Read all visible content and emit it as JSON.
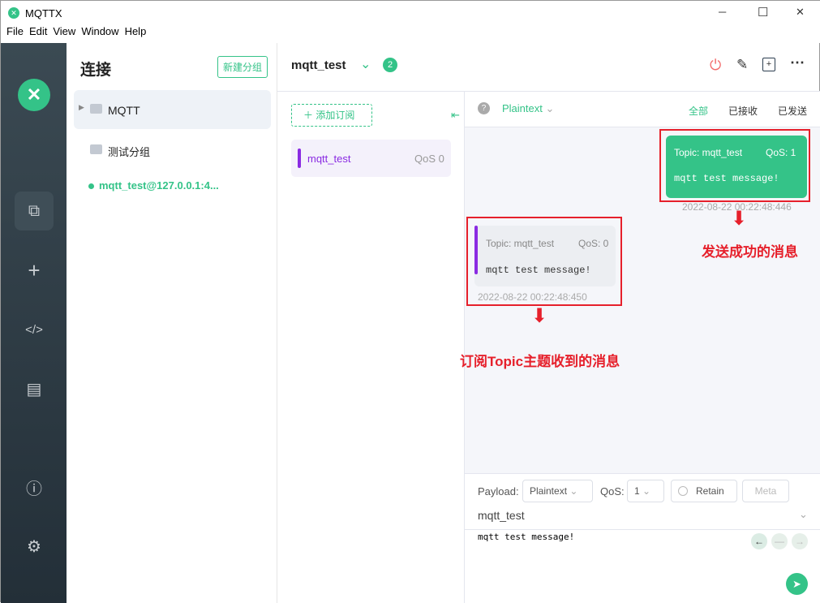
{
  "window": {
    "title": "MQTTX",
    "minimize": "─",
    "maximize": "☐",
    "close": "✕"
  },
  "menu": [
    "File",
    "Edit",
    "View",
    "Window",
    "Help"
  ],
  "connections": {
    "title": "连接",
    "new_group": "新建分组",
    "groups": [
      "MQTT",
      "测试分组"
    ],
    "active": "mqtt_test@127.0.0.1:4..."
  },
  "header": {
    "name": "mqtt_test",
    "badge": "2"
  },
  "subscriptions": {
    "add": "添加订阅",
    "items": [
      {
        "topic": "mqtt_test",
        "qos": "QoS 0",
        "color": "#8a2be2"
      }
    ]
  },
  "messages": {
    "format": "Plaintext",
    "filters": [
      "全部",
      "已接收",
      "已发送"
    ],
    "sent": {
      "topic": "Topic: mqtt_test",
      "qos": "QoS: 1",
      "payload": "mqtt test message!",
      "time": "2022-08-22 00:22:48:446"
    },
    "received": {
      "topic": "Topic: mqtt_test",
      "qos": "QoS: 0",
      "payload": "mqtt test message!",
      "time": "2022-08-22 00:22:48:450"
    }
  },
  "annotations": {
    "sent": "发送成功的消息",
    "received": "订阅Topic主题收到的消息"
  },
  "composer": {
    "payload_label": "Payload:",
    "payload_format": "Plaintext",
    "qos_label": "QoS:",
    "qos": "1",
    "retain": "Retain",
    "meta": "Meta",
    "topic": "mqtt_test",
    "payload": "mqtt test message!"
  },
  "colors": {
    "accent": "#34c388",
    "annotation": "#e6202b"
  }
}
